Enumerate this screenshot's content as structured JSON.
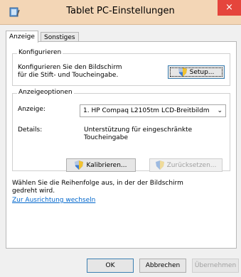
{
  "window": {
    "title": "Tablet PC-Einstellungen",
    "close_glyph": "×",
    "icon": "tablet-pc-icon"
  },
  "tabs": [
    {
      "label": "Anzeige",
      "active": true
    },
    {
      "label": "Sonstiges",
      "active": false
    }
  ],
  "configure": {
    "legend": "Konfigurieren",
    "line1": "Konfigurieren Sie den Bildschirm",
    "line2": "für die Stift- und Toucheingabe.",
    "setup_label": "Setup..."
  },
  "display_options": {
    "legend": "Anzeigeoptionen",
    "display_label": "Anzeige:",
    "display_value": "1. HP Compaq L2105tm LCD-Breitbildm",
    "details_label": "Details:",
    "details_line1": "Unterstützung für eingeschränkte",
    "details_line2": "Toucheingabe",
    "calibrate_label": "Kalibrieren...",
    "reset_label": "Zurücksetzen..."
  },
  "orientation": {
    "line1": "Wählen Sie die Reihenfolge aus, in der der Bildschirm",
    "line2": "gedreht wird.",
    "link": "Zur Ausrichtung wechseln"
  },
  "footer": {
    "ok": "OK",
    "cancel": "Abbrechen",
    "apply": "Übernehmen"
  },
  "colors": {
    "titlebar": "#f3d6b6",
    "close": "#e5453c",
    "link": "#0066cc"
  }
}
